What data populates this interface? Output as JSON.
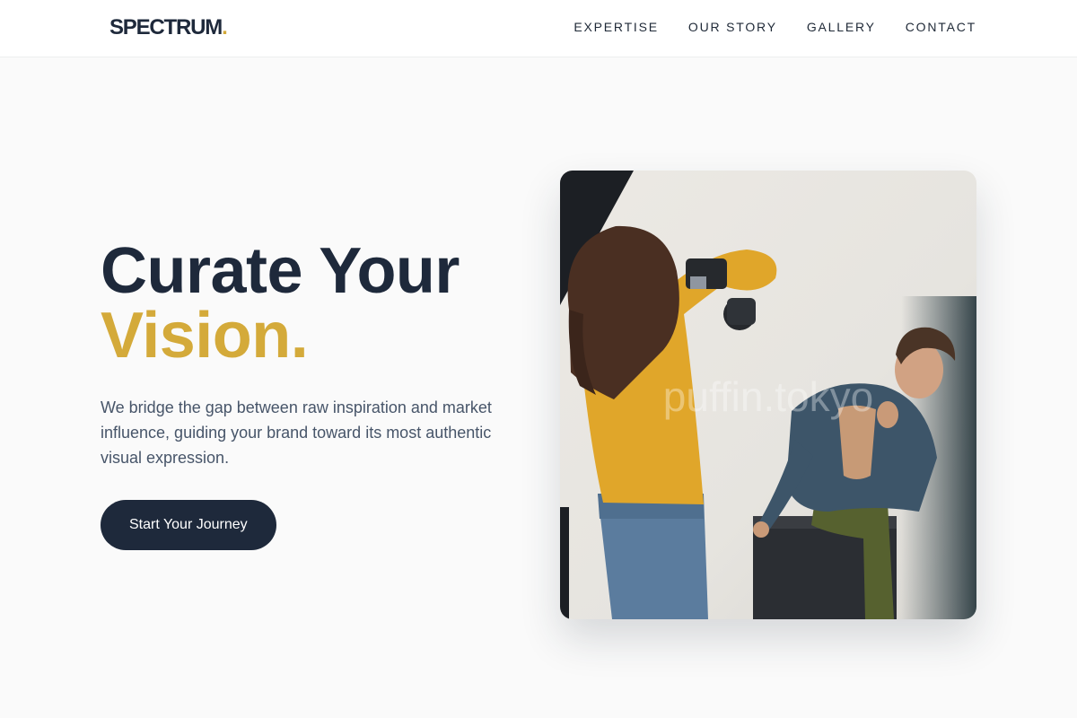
{
  "brand": {
    "name": "SPECTRUM",
    "dot": "."
  },
  "nav": {
    "items": [
      {
        "label": "EXPERTISE"
      },
      {
        "label": "OUR STORY"
      },
      {
        "label": "GALLERY"
      },
      {
        "label": "CONTACT"
      }
    ]
  },
  "hero": {
    "headline_line1": "Curate Your",
    "headline_line2": "Vision.",
    "description": "We bridge the gap between raw inspiration and market influence, guiding your brand toward its most authentic visual expression.",
    "cta_label": "Start Your Journey"
  },
  "image": {
    "watermark": "puffin.tokyo",
    "subject": "photographer in mustard sweater photographing a seated male model in a denim jacket"
  },
  "colors": {
    "primary": "#1e293b",
    "accent": "#d4aa3a",
    "body_text": "#475569",
    "background": "#fafafa"
  }
}
